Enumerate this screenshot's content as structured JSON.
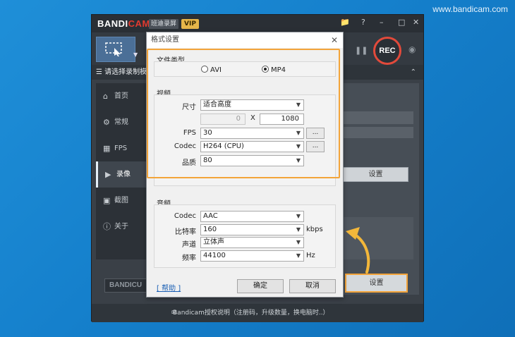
{
  "watermark": "www.bandicam.com",
  "app": {
    "logo_main": "BANDI",
    "logo_accent": "CAM",
    "subtitle": "班迪录屏",
    "vip": "VIP",
    "select_region": "请选择录制模",
    "rec_label": "REC",
    "brand_box": "BANDICU",
    "footer": "Bandicam授权说明（注册码，升级数量，换电脑时..）",
    "settings_btn": "设置",
    "settings_btn_highlighted": "设置",
    "sidebar": [
      {
        "label": "首页",
        "icon": "home-icon"
      },
      {
        "label": "常规",
        "icon": "gear-icon"
      },
      {
        "label": "FPS",
        "icon": "fps-icon"
      },
      {
        "label": "录像",
        "icon": "video-icon"
      },
      {
        "label": "截图",
        "icon": "image-icon"
      },
      {
        "label": "关于",
        "icon": "info-icon"
      }
    ],
    "active_sidebar": "录像"
  },
  "dialog": {
    "title": "格式设置",
    "file_type_label": "文件类型",
    "file_type_options": [
      "AVI",
      "MP4"
    ],
    "file_type_selected": "MP4",
    "video_label": "视频",
    "size_label": "尺寸",
    "size_value": "适合高度",
    "width_value": "0",
    "x_label": "X",
    "height_value": "1080",
    "fps_label": "FPS",
    "fps_value": "30",
    "codec_label": "Codec",
    "codec_value": "H264 (CPU)",
    "quality_label": "品质",
    "quality_value": "80",
    "more_button": "...",
    "audio_label": "音频",
    "audio_codec_label": "Codec",
    "audio_codec_value": "AAC",
    "bitrate_label": "比特率",
    "bitrate_value": "160",
    "bitrate_unit": "kbps",
    "channel_label": "声道",
    "channel_value": "立体声",
    "freq_label": "频率",
    "freq_value": "44100",
    "freq_unit": "Hz",
    "help_link": "[ 帮助 ]",
    "ok_button": "确定",
    "cancel_button": "取消"
  },
  "colors": {
    "highlight": "#f3a43a",
    "rec_ring": "#e24a3b",
    "background": "#1580cc"
  }
}
